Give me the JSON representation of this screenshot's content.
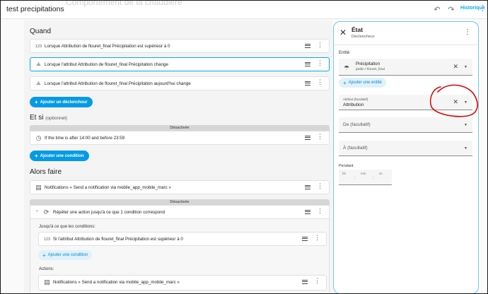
{
  "topbar": {
    "title": "test precipitations",
    "ghost_title": "Comportement de la chaudière",
    "history_label": "Historique",
    "undo_icon": "undo-icon",
    "redo_icon": "redo-icon",
    "more_icon": "more-vertical-icon"
  },
  "editor": {
    "when_title": "Quand",
    "triggers": [
      {
        "icon": "numeric-icon",
        "icon_glyph": "123",
        "text": "Lorsque Attribution de flouret_final Précipitation est supérieur à 0"
      },
      {
        "icon": "state-icon",
        "icon_glyph": "⟁",
        "text": "Lorsque l'attribut Attribution de flouret_final Précipitation change"
      },
      {
        "icon": "state-icon",
        "icon_glyph": "⟁",
        "text": "Lorsque l'attribut Attribution de flouret_final Précipitation aujourd'hui change"
      }
    ],
    "add_trigger_label": "Ajouter un déclencheur",
    "if_title": "Et si",
    "if_optional": "(optionnel)",
    "condition_disabled_label": "Désactivée",
    "condition_text": "If the time is after 14:00 and before 23:59",
    "add_condition_label": "Ajouter une condition",
    "then_title": "Alors faire",
    "action_notify_text": "Notifications « Send a notification via mobile_app_mobile_marc »",
    "repeat_disabled_label": "Désactivée",
    "repeat_text": "Répéter une action jusqu'à ce que 1 condition correspond",
    "until_label": "Jusqu'à ce que les conditions:",
    "until_condition_text": "Si l'attribut Attribution de flouret_final Précipitation est supérieur à 0",
    "until_add_condition_label": "Ajouter une condition",
    "actions_label": "Actions:",
    "nested_action_text": "Notifications « Send a notification via mobile_app_mobile_marc »"
  },
  "panel": {
    "title": "État",
    "subtitle": "Déclencheur",
    "entity_label": "Entité",
    "entity_name": "Précipitation",
    "entity_id": "jardin • flouret_final",
    "add_entity_label": "Ajouter une entité",
    "attribute_small_label": "Attribut (facultatif)",
    "attribute_value": "Attribution",
    "from_placeholder": "De (facultatif)",
    "to_placeholder": "À (facultatif)",
    "duration_label": "Pendant",
    "duration_units": [
      "hh",
      "mm",
      "ss"
    ]
  },
  "colors": {
    "accent": "#039be5",
    "panel_border": "#6ec6f0",
    "annotation": "#e00000"
  }
}
